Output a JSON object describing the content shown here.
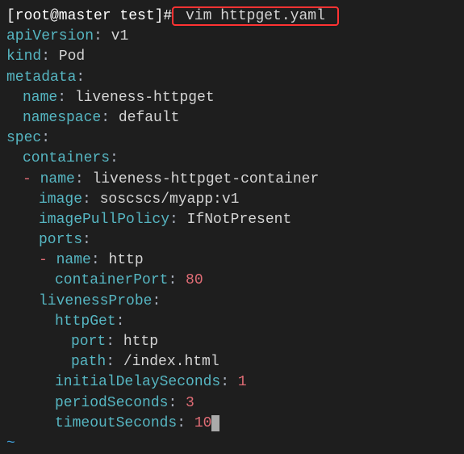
{
  "prompt": {
    "prefix": "[root@master test]#",
    "command": " vim httpget.yaml "
  },
  "yaml": {
    "apiVersion": {
      "key": "apiVersion",
      "value": "v1"
    },
    "kind": {
      "key": "kind",
      "value": "Pod"
    },
    "metadata": {
      "key": "metadata",
      "name": {
        "key": "name",
        "value": "liveness-httpget"
      },
      "namespace": {
        "key": "namespace",
        "value": "default"
      }
    },
    "spec": {
      "key": "spec",
      "containers": {
        "key": "containers",
        "item": {
          "name": {
            "key": "name",
            "value": "liveness-httpget-container"
          },
          "image": {
            "key": "image",
            "value": "soscscs/myapp:v1"
          },
          "imagePullPolicy": {
            "key": "imagePullPolicy",
            "value": "IfNotPresent"
          },
          "ports": {
            "key": "ports",
            "item": {
              "name": {
                "key": "name",
                "value": "http"
              },
              "containerPort": {
                "key": "containerPort",
                "value": "80"
              }
            }
          },
          "livenessProbe": {
            "key": "livenessProbe",
            "httpGet": {
              "key": "httpGet",
              "port": {
                "key": "port",
                "value": "http"
              },
              "path": {
                "key": "path",
                "value": "/index.html"
              }
            },
            "initialDelaySeconds": {
              "key": "initialDelaySeconds",
              "value": "1"
            },
            "periodSeconds": {
              "key": "periodSeconds",
              "value": "3"
            },
            "timeoutSeconds": {
              "key": "timeoutSeconds",
              "value": "10"
            }
          }
        }
      }
    }
  },
  "tilde": "~"
}
